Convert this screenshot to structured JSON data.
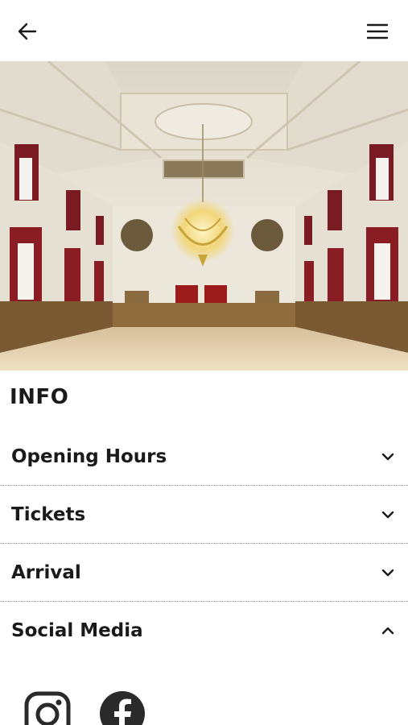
{
  "header": {
    "back_icon": "arrow-left-icon",
    "menu_icon": "hamburger-menu-icon"
  },
  "hero": {
    "image": "ornate-ballroom-photo"
  },
  "info": {
    "title": "INFO",
    "items": [
      {
        "label": "Opening Hours",
        "state": "collapsed",
        "icon": "chevron-down-icon"
      },
      {
        "label": "Tickets",
        "state": "collapsed",
        "icon": "chevron-down-icon"
      },
      {
        "label": "Arrival",
        "state": "collapsed",
        "icon": "chevron-down-icon"
      },
      {
        "label": "Social Media",
        "state": "expanded",
        "icon": "chevron-up-icon"
      }
    ]
  },
  "social": {
    "icons": [
      "instagram-icon",
      "facebook-icon"
    ]
  },
  "colors": {
    "text": "#1a1a1a",
    "divider": "#9a9a9a",
    "background": "#ffffff"
  }
}
